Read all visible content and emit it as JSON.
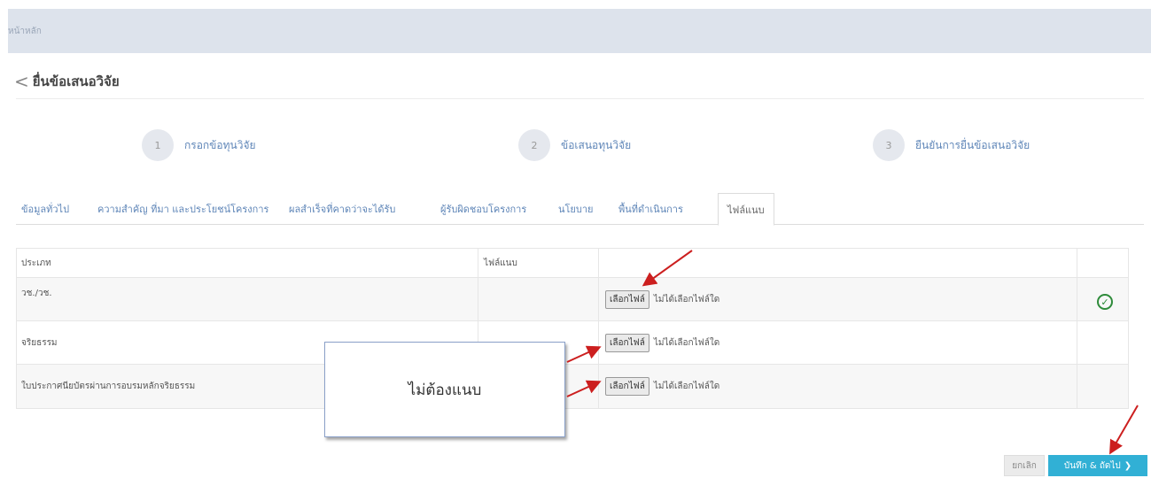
{
  "topbar": {
    "breadcrumb": "หน้าหลัก"
  },
  "page": {
    "title": "ยื่นข้อเสนอวิจัย"
  },
  "steps": [
    {
      "number": "1",
      "label": "กรอกข้อทุนวิจัย"
    },
    {
      "number": "2",
      "label": "ข้อเสนอทุนวิจัย"
    },
    {
      "number": "3",
      "label": "ยืนยันการยื่นข้อเสนอวิจัย"
    }
  ],
  "tabs": [
    "ข้อมูลทั่วไป",
    "ความสำคัญ ที่มา และประโยชน์โครงการ",
    "ผลสำเร็จที่คาดว่าจะได้รับ",
    "ผู้รับผิดชอบโครงการ",
    "นโยบาย",
    "พื้นที่ดำเนินการ",
    "ไฟล์แนบ"
  ],
  "table": {
    "headers": [
      "ประเภท",
      "ไฟล์แนบ"
    ],
    "rows": [
      {
        "type": "วช./วช.",
        "button": "เลือกไฟล์",
        "status": "ไม่ได้เลือกไฟล์ใด"
      },
      {
        "type": "จริยธรรม",
        "button": "เลือกไฟล์",
        "status": "ไม่ได้เลือกไฟล์ใด"
      },
      {
        "type": "ใบประกาศนียบัตรผ่านการอบรมหลักจริยธรรม",
        "button": "เลือกไฟล์",
        "status": "ไม่ได้เลือกไฟล์ใด"
      }
    ]
  },
  "note": {
    "text": "ไม่ต้องแนบ"
  },
  "buttons": {
    "cancel": "ยกเลิก",
    "save": "บันทึก & ถัดไป"
  },
  "icons": {
    "back": "chevron-left-icon",
    "done": "check-circle-icon",
    "next": "chevron-right-icon"
  },
  "colors": {
    "accent": "#31b0d5",
    "link": "#5f86b8",
    "success": "#2e8b3a",
    "annotation": "#cc1f1f",
    "topbar": "#dde3ec"
  }
}
